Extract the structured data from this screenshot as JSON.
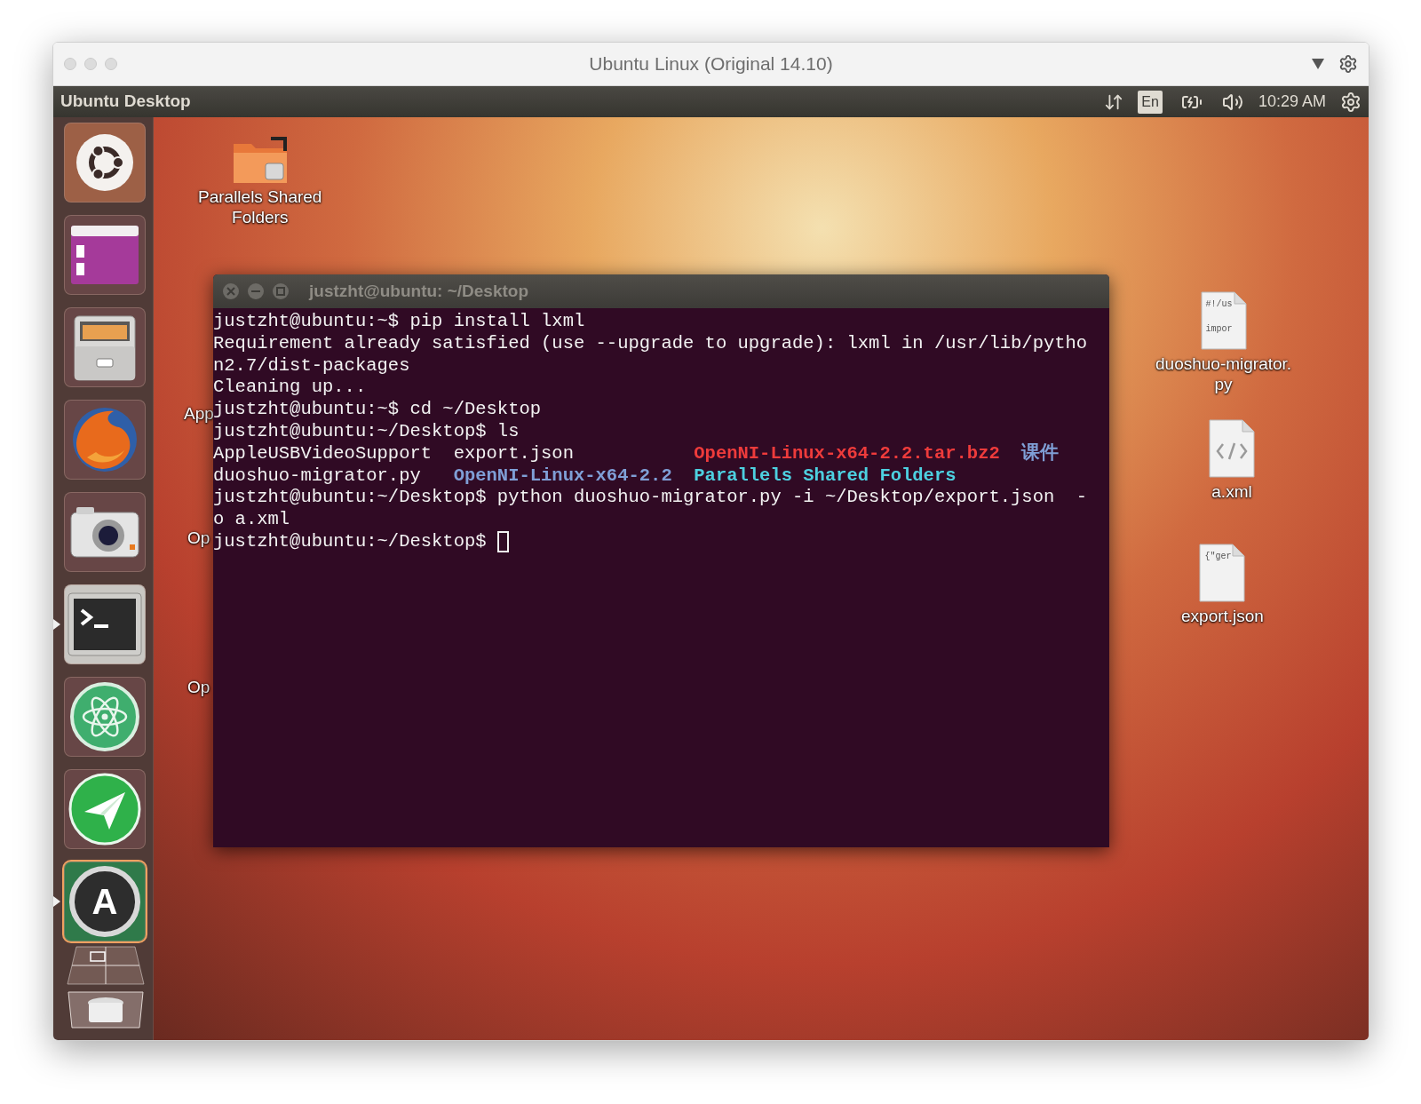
{
  "mac_window": {
    "title": "Ubuntu Linux (Original 14.10)"
  },
  "panel": {
    "title": "Ubuntu Desktop",
    "indicators": [
      {
        "kind": "transfer"
      },
      {
        "kind": "keyboard",
        "label": "En"
      },
      {
        "kind": "battery"
      },
      {
        "kind": "volume"
      },
      {
        "kind": "clock",
        "label": "10:29 AM"
      },
      {
        "kind": "session"
      }
    ]
  },
  "launcher": {
    "items": [
      {
        "kind": "dash",
        "running": false
      },
      {
        "kind": "window-app",
        "running": false
      },
      {
        "kind": "files",
        "running": false
      },
      {
        "kind": "browser",
        "running": false
      },
      {
        "kind": "camera",
        "running": false
      },
      {
        "kind": "terminal",
        "running": true
      },
      {
        "kind": "atom",
        "running": false
      },
      {
        "kind": "plane",
        "running": false
      },
      {
        "kind": "updater",
        "glyph": "A",
        "running": true
      },
      {
        "kind": "workspaces",
        "running": false
      },
      {
        "kind": "trash",
        "running": false
      }
    ]
  },
  "desktop": {
    "icons": [
      {
        "kind": "folder",
        "lines": [
          "Parallels Shared",
          "Folders"
        ]
      },
      {
        "kind": "covered",
        "lines": [
          "App"
        ]
      },
      {
        "kind": "covered",
        "lines": [
          "Op"
        ]
      },
      {
        "kind": "covered",
        "lines": [
          "Op"
        ]
      },
      {
        "kind": "script",
        "preview": [
          "#!/us",
          "impor"
        ],
        "lines": [
          "duoshuo-migrator.",
          "py"
        ]
      },
      {
        "kind": "code",
        "lines": [
          "a.xml"
        ]
      },
      {
        "kind": "text",
        "preview": [
          "{\"ger"
        ],
        "lines": [
          "export.json"
        ]
      }
    ]
  },
  "terminal": {
    "title": "justzht@ubuntu: ~/Desktop",
    "cursor": true,
    "lines": [
      {
        "text": "justzht@ubuntu:~$ pip install lxml"
      },
      {
        "text": "Requirement already satisfied (use --upgrade to upgrade): lxml in /usr/lib/pytho"
      },
      {
        "text": "n2.7/dist-packages"
      },
      {
        "text": "Cleaning up..."
      },
      {
        "text": "justzht@ubuntu:~$ cd ~/Desktop"
      },
      {
        "text": "justzht@ubuntu:~/Desktop$ ls"
      },
      {
        "segments": [
          {
            "text": "AppleUSBVideoSupport"
          },
          {
            "text": "export.json"
          },
          {
            "text": "OpenNI-Linux-x64-2.2.tar.bz2",
            "color": "#ee3b3b"
          },
          {
            "text": "课件",
            "color": "#7f9fd6"
          }
        ]
      },
      {
        "segments": [
          {
            "text": "duoshuo-migrator.py"
          },
          {
            "text": "OpenNI-Linux-x64-2.2",
            "color": "#7f9fd6"
          },
          {
            "text": "Parallels Shared Folders",
            "color": "#4dd0e0"
          }
        ]
      },
      {
        "text": "justzht@ubuntu:~/Desktop$ python duoshuo-migrator.py -i ~/Desktop/export.json  -"
      },
      {
        "text": "o a.xml"
      },
      {
        "text": "justzht@ubuntu:~/Desktop$ "
      }
    ]
  }
}
